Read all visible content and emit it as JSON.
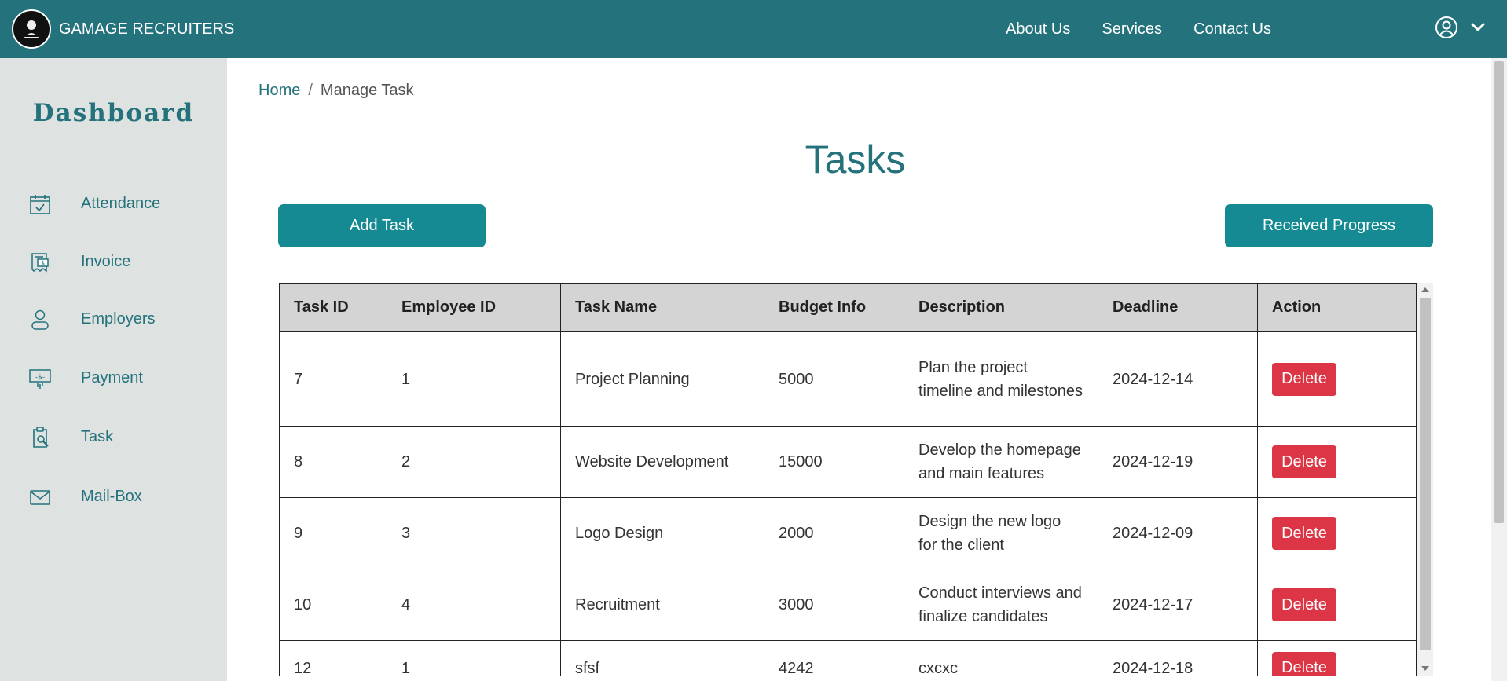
{
  "navbar": {
    "brand": "GAMAGE RECRUITERS",
    "links": [
      "About Us",
      "Services",
      "Contact Us"
    ]
  },
  "sidebar": {
    "title": "Dashboard",
    "items": [
      {
        "label": "Attendance",
        "icon": "calendar-check-icon"
      },
      {
        "label": "Invoice",
        "icon": "invoice-icon"
      },
      {
        "label": "Employers",
        "icon": "person-icon"
      },
      {
        "label": "Payment",
        "icon": "payment-icon"
      },
      {
        "label": "Task",
        "icon": "clipboard-search-icon"
      },
      {
        "label": "Mail-Box",
        "icon": "envelope-icon"
      }
    ]
  },
  "breadcrumb": {
    "home": "Home",
    "separator": "/",
    "current": "Manage Task"
  },
  "page": {
    "title": "Tasks"
  },
  "buttons": {
    "add_task": "Add Task",
    "received_progress": "Received Progress"
  },
  "table": {
    "headers": [
      "Task ID",
      "Employee ID",
      "Task Name",
      "Budget Info",
      "Description",
      "Deadline",
      "Action"
    ],
    "rows": [
      {
        "task_id": "7",
        "employee_id": "1",
        "task_name": "Project Planning",
        "budget": "5000",
        "description": "Plan the project timeline and milestones",
        "deadline": "2024-12-14",
        "action": "Delete"
      },
      {
        "task_id": "8",
        "employee_id": "2",
        "task_name": "Website Development",
        "budget": "15000",
        "description": "Develop the homepage and main features",
        "deadline": "2024-12-19",
        "action": "Delete"
      },
      {
        "task_id": "9",
        "employee_id": "3",
        "task_name": "Logo Design",
        "budget": "2000",
        "description": "Design the new logo for the client",
        "deadline": "2024-12-09",
        "action": "Delete"
      },
      {
        "task_id": "10",
        "employee_id": "4",
        "task_name": "Recruitment",
        "budget": "3000",
        "description": "Conduct interviews and finalize candidates",
        "deadline": "2024-12-17",
        "action": "Delete"
      },
      {
        "task_id": "12",
        "employee_id": "1",
        "task_name": "sfsf",
        "budget": "4242",
        "description": "cxcxc",
        "deadline": "2024-12-18",
        "action": "Delete"
      }
    ]
  },
  "colors": {
    "primary": "#23727c",
    "button": "#168a92",
    "danger": "#dc3545",
    "sidebar_bg": "#dee2e1",
    "header_bg": "#d4d4d4"
  }
}
